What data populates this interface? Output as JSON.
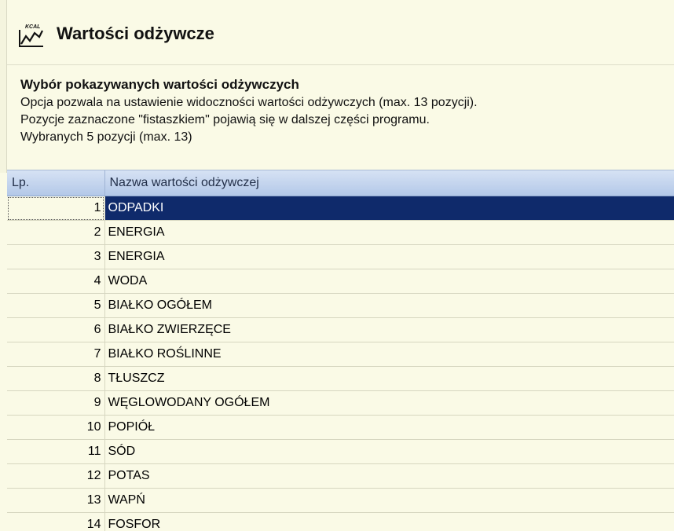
{
  "header": {
    "icon_label": "KCAL",
    "title": "Wartości odżywcze"
  },
  "info": {
    "heading": "Wybór pokazywanych wartości odżywczych",
    "line1": "Opcja pozwala na ustawienie widoczności wartości odżywczych (max. 13 pozycji).",
    "line2": "Pozycje zaznaczone \"fistaszkiem\" pojawią się w dalszej części programu.",
    "line3": "Wybranych 5 pozycji (max. 13)"
  },
  "grid": {
    "columns": {
      "lp": "Lp.",
      "name": "Nazwa wartości odżywczej"
    },
    "rows": [
      {
        "lp": "1",
        "name": "ODPADKI",
        "selected": true
      },
      {
        "lp": "2",
        "name": "ENERGIA"
      },
      {
        "lp": "3",
        "name": "ENERGIA"
      },
      {
        "lp": "4",
        "name": "WODA"
      },
      {
        "lp": "5",
        "name": "BIAŁKO OGÓŁEM"
      },
      {
        "lp": "6",
        "name": "BIAŁKO ZWIERZĘCE"
      },
      {
        "lp": "7",
        "name": "BIAŁKO ROŚLINNE"
      },
      {
        "lp": "8",
        "name": "TŁUSZCZ"
      },
      {
        "lp": "9",
        "name": "WĘGLOWODANY OGÓŁEM"
      },
      {
        "lp": "10",
        "name": "POPIÓŁ"
      },
      {
        "lp": "11",
        "name": "SÓD"
      },
      {
        "lp": "12",
        "name": "POTAS"
      },
      {
        "lp": "13",
        "name": "WAPŃ"
      },
      {
        "lp": "14",
        "name": "FOSFOR"
      }
    ]
  },
  "colors": {
    "background": "#fafae6",
    "selection": "#0f2a6b",
    "header_gradient_top": "#d6e2f4",
    "header_gradient_bottom": "#b3c8e8"
  }
}
